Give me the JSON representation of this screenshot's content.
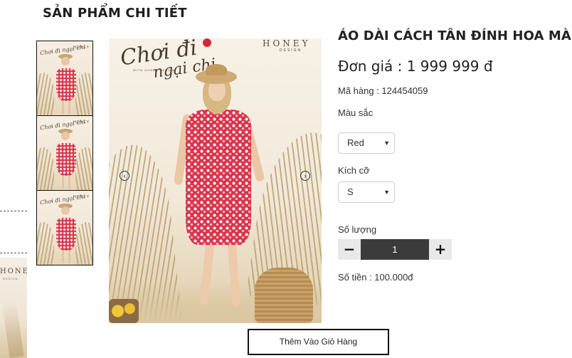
{
  "page": {
    "section_title": "SẢN PHẨM CHI TIẾT"
  },
  "edge": {
    "brand": "HONEY",
    "brand_sub": "DESIGN"
  },
  "gallery": {
    "thumbnails": [
      {
        "script": "Chơi đi ngại chi",
        "brand": "HONEY"
      },
      {
        "script": "Chơi đi ngại chi",
        "brand": "HONEY"
      },
      {
        "script": "Chơi đi ngại chi",
        "brand": "HONEY"
      }
    ],
    "main_image": {
      "script_line1": "Chơi đi",
      "script_line2": "ngại chi",
      "with_text": "WITH HONEY DESIGN",
      "brand": "HONEY",
      "brand_sub": "DESIGN",
      "prev_icon": "‹",
      "next_icon": "›"
    }
  },
  "product": {
    "title": "ÁO DÀI CÁCH TÂN ĐÍNH HOA MÀU",
    "price": "Đơn giá : 1 999 999 đ",
    "code": "Mã hàng : 124454059",
    "color_label": "Màu sắc",
    "color_selected": "Red",
    "size_label": "Kích cỡ",
    "size_selected": "S",
    "qty_label": "Số lượng",
    "qty_minus": "−",
    "qty_value": "1",
    "qty_plus": "+",
    "total": "Số tiền : 100.000đ",
    "add_to_cart": "Thêm Vào Giỏ Hàng"
  },
  "colors": {
    "dress": "#d8354c",
    "qty_bg": "#3b3b3b"
  }
}
